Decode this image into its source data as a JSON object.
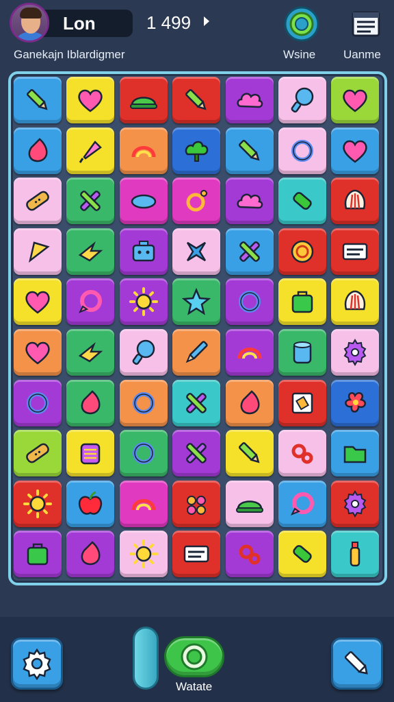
{
  "player": {
    "name": "Lon",
    "score": "1 499",
    "subtitle": "Ganekajn Iblardigmer"
  },
  "top_buttons": {
    "left_label": "Wsine",
    "right_label": "Uanme"
  },
  "bottom": {
    "center_label": "Watate"
  },
  "colors": {
    "background": "#2b3a52",
    "board_border": "#7fd0e8",
    "accent_green": "#3fc44a",
    "accent_blue": "#3aa8e0"
  },
  "board": {
    "rows": 10,
    "cols": 7,
    "tiles": [
      [
        [
          "#3aa0e6",
          "pencil"
        ],
        [
          "#f5e12a",
          "heart"
        ],
        [
          "#e0302a",
          "helmet"
        ],
        [
          "#e0302a",
          "pencil"
        ],
        [
          "#a43ad6",
          "cloud"
        ],
        [
          "#f7c0e8",
          "flask"
        ],
        [
          "#9ad83a",
          "heart"
        ]
      ],
      [
        [
          "#3aa0e6",
          "drop"
        ],
        [
          "#f5e12a",
          "rocket"
        ],
        [
          "#f5924a",
          "rainbow"
        ],
        [
          "#2c6fd6",
          "tree"
        ],
        [
          "#3aa0e6",
          "pencil"
        ],
        [
          "#f7c0e8",
          "ring"
        ],
        [
          "#3aa0e6",
          "heart"
        ]
      ],
      [
        [
          "#f7c0e8",
          "bandage"
        ],
        [
          "#3ab86a",
          "cross"
        ],
        [
          "#e03ac0",
          "oval"
        ],
        [
          "#e03ac0",
          "gear-ring"
        ],
        [
          "#a43ad6",
          "cloud"
        ],
        [
          "#3ac8c8",
          "bar"
        ],
        [
          "#e0302a",
          "shell"
        ]
      ],
      [
        [
          "#f7c0e8",
          "kite"
        ],
        [
          "#3ab86a",
          "bird"
        ],
        [
          "#a43ad6",
          "robot"
        ],
        [
          "#f7c0e8",
          "star4"
        ],
        [
          "#3aa0e6",
          "cross"
        ],
        [
          "#e0302a",
          "coin"
        ],
        [
          "#e0302a",
          "panel"
        ]
      ],
      [
        [
          "#f5e12a",
          "heart"
        ],
        [
          "#a43ad6",
          "chat"
        ],
        [
          "#a43ad6",
          "sun"
        ],
        [
          "#3ab86a",
          "star"
        ],
        [
          "#a43ad6",
          "ring"
        ],
        [
          "#f5e12a",
          "bag"
        ],
        [
          "#f5e12a",
          "shell"
        ]
      ],
      [
        [
          "#f5924a",
          "heart"
        ],
        [
          "#3ab86a",
          "bird"
        ],
        [
          "#f7c0e8",
          "flask"
        ],
        [
          "#f5924a",
          "pen"
        ],
        [
          "#a43ad6",
          "rainbow"
        ],
        [
          "#3ab86a",
          "cup"
        ],
        [
          "#f7c0e8",
          "gear"
        ]
      ],
      [
        [
          "#a43ad6",
          "ring"
        ],
        [
          "#3ab86a",
          "drop"
        ],
        [
          "#f5924a",
          "ring"
        ],
        [
          "#3ac8c8",
          "cross"
        ],
        [
          "#f5924a",
          "drop"
        ],
        [
          "#e0302a",
          "tag"
        ],
        [
          "#2c6fd6",
          "flower"
        ]
      ],
      [
        [
          "#9ad83a",
          "bandage"
        ],
        [
          "#f5e12a",
          "box"
        ],
        [
          "#3ab86a",
          "ring"
        ],
        [
          "#a43ad6",
          "cross"
        ],
        [
          "#f5e12a",
          "pencil"
        ],
        [
          "#f7c0e8",
          "rings"
        ],
        [
          "#3aa0e6",
          "folder"
        ]
      ],
      [
        [
          "#e0302a",
          "sun"
        ],
        [
          "#3aa0e6",
          "apple"
        ],
        [
          "#e03ac0",
          "rainbow"
        ],
        [
          "#e0302a",
          "dots"
        ],
        [
          "#f7c0e8",
          "helmet"
        ],
        [
          "#3aa0e6",
          "chat"
        ],
        [
          "#e0302a",
          "gear"
        ]
      ],
      [
        [
          "#a43ad6",
          "bag"
        ],
        [
          "#a43ad6",
          "drop"
        ],
        [
          "#f7c0e8",
          "sun"
        ],
        [
          "#e0302a",
          "panel"
        ],
        [
          "#a43ad6",
          "rings"
        ],
        [
          "#f5e12a",
          "bar"
        ],
        [
          "#3ac8c8",
          "bottle"
        ]
      ]
    ]
  }
}
